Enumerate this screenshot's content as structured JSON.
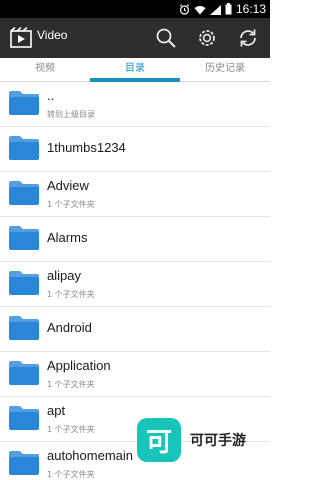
{
  "status_bar": {
    "time": "16:13",
    "icons": [
      "alarm-icon",
      "wifi-icon",
      "signal-icon",
      "battery-icon"
    ]
  },
  "app": {
    "title": "Video",
    "actions": [
      "search-icon",
      "settings-icon",
      "refresh-icon"
    ]
  },
  "tabs": [
    {
      "label": "视频",
      "active": false
    },
    {
      "label": "目录",
      "active": true
    },
    {
      "label": "历史记录",
      "active": false
    }
  ],
  "list": [
    {
      "title": "..",
      "subtitle": "转到上级目录"
    },
    {
      "title": "1thumbs1234",
      "subtitle": ""
    },
    {
      "title": "Adview",
      "subtitle": "1 个子文件夹"
    },
    {
      "title": "Alarms",
      "subtitle": ""
    },
    {
      "title": "alipay",
      "subtitle": "1 个子文件夹"
    },
    {
      "title": "Android",
      "subtitle": ""
    },
    {
      "title": "Application",
      "subtitle": "1 个子文件夹"
    },
    {
      "title": "apt",
      "subtitle": "1 个子文件夹"
    },
    {
      "title": "autohomemain",
      "subtitle": "1 个子文件夹"
    }
  ],
  "watermark": {
    "logo_char": "可",
    "text": "可可手游"
  },
  "colors": {
    "accent": "#1c8fbf",
    "folder": "#2a86d8",
    "watermark": "#19c4b8"
  }
}
